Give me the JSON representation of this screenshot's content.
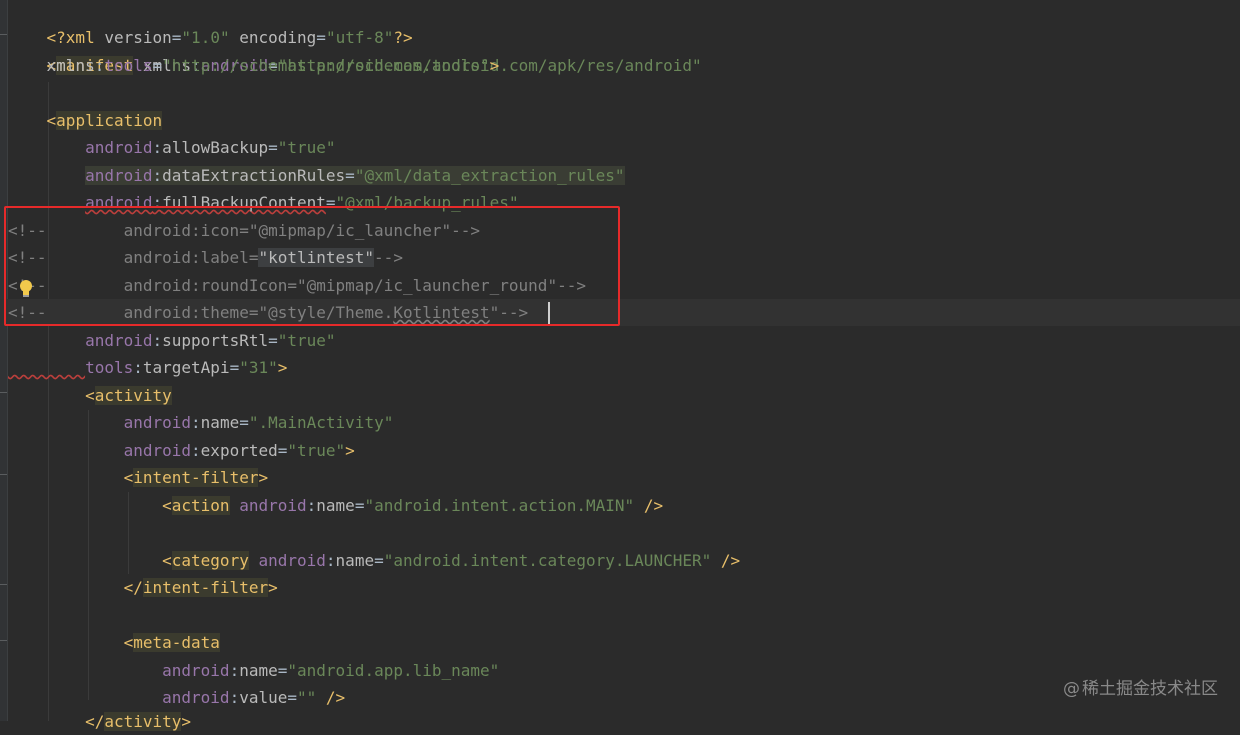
{
  "editor": {
    "lines": [
      {
        "id": "l1",
        "text": "<?xml version=\"1.0\" encoding=\"utf-8\"?>"
      },
      {
        "id": "l2",
        "text": "<manifest xmlns:android=\"http://schemas.android.com/apk/res/android\""
      },
      {
        "id": "l3",
        "text": "    xmlns:tools=\"http://schemas.android.com/tools\">"
      },
      {
        "id": "l4",
        "text": ""
      },
      {
        "id": "l5",
        "text": "    <application"
      },
      {
        "id": "l6",
        "text": "        android:allowBackup=\"true\""
      },
      {
        "id": "l7",
        "text": "        android:dataExtractionRules=\"@xml/data_extraction_rules\""
      },
      {
        "id": "l8",
        "text": "        android:fullBackupContent=\"@xml/backup_rules\""
      },
      {
        "id": "l9",
        "text": "<!--        android:icon=\"@mipmap/ic_launcher\"-->"
      },
      {
        "id": "l10",
        "text": "<!--        android:label=\"kotlintest\"-->"
      },
      {
        "id": "l11",
        "text": "<!--        android:roundIcon=\"@mipmap/ic_launcher_round\"-->"
      },
      {
        "id": "l12",
        "text": "<!--        android:theme=\"@style/Theme.Kotlintest\"-->"
      },
      {
        "id": "l13",
        "text": "        android:supportsRtl=\"true\""
      },
      {
        "id": "l14",
        "text": "        tools:targetApi=\"31\">"
      },
      {
        "id": "l15",
        "text": "        <activity"
      },
      {
        "id": "l16",
        "text": "            android:name=\".MainActivity\""
      },
      {
        "id": "l17",
        "text": "            android:exported=\"true\">"
      },
      {
        "id": "l18",
        "text": "            <intent-filter>"
      },
      {
        "id": "l19",
        "text": "                <action android:name=\"android.intent.action.MAIN\" />"
      },
      {
        "id": "l20",
        "text": ""
      },
      {
        "id": "l21",
        "text": "                <category android:name=\"android.intent.category.LAUNCHER\" />"
      },
      {
        "id": "l22",
        "text": "            </intent-filter>"
      },
      {
        "id": "l23",
        "text": ""
      },
      {
        "id": "l24",
        "text": "            <meta-data"
      },
      {
        "id": "l25",
        "text": "                android:name=\"android.app.lib_name\""
      },
      {
        "id": "l26",
        "text": "                android:value=\"\" />"
      },
      {
        "id": "l27",
        "text": "        </activity>"
      }
    ],
    "highlight_box_color": "#e62a2a",
    "intention_icon": "lightbulb-icon"
  },
  "watermark": {
    "symbol": "@",
    "text": "稀土掘金技术社区"
  },
  "colors": {
    "background": "#2b2b2b",
    "tag": "#e8bf6a",
    "namespace": "#9876aa",
    "value": "#6a8759",
    "comment": "#808080",
    "text": "#a9b7c6"
  }
}
